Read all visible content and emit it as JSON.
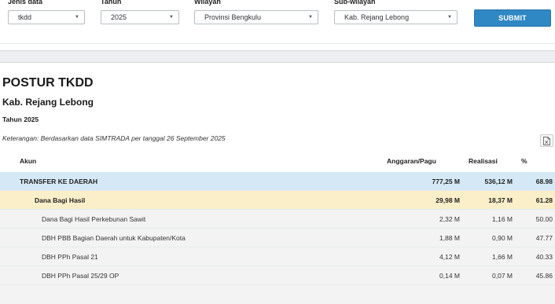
{
  "filters": [
    {
      "label": "Jenis data",
      "value": "tkdd"
    },
    {
      "label": "Tahun",
      "value": "2025"
    },
    {
      "label": "Wilayah",
      "value": "Provinsi Bengkulu"
    },
    {
      "label": "Sub-wilayah",
      "value": "Kab. Rejang Lebong"
    }
  ],
  "submit_label": "SUBMIT",
  "report": {
    "title": "POSTUR TKDD",
    "region": "Kab. Rejang Lebong",
    "year": "Tahun 2025",
    "note": "Keterangan: Berdasarkan data SIMTRADA per tanggal 26 September 2025"
  },
  "export_icon": "excel-export-icon",
  "table": {
    "headers": {
      "akun": "Akun",
      "anggaran": "Anggaran/Pagu",
      "realisasi": "Realisasi",
      "persen": "%"
    },
    "rows": [
      {
        "akun": "TRANSFER KE DAERAH",
        "anggaran": "777,25 M",
        "realisasi": "536,12 M",
        "persen": "68.98"
      },
      {
        "akun": "Dana Bagi Hasil",
        "anggaran": "29,98 M",
        "realisasi": "18,37 M",
        "persen": "61.28"
      },
      {
        "akun": "Dana Bagi Hasil Perkebunan Sawit",
        "anggaran": "2,32 M",
        "realisasi": "1,16 M",
        "persen": "50.00"
      },
      {
        "akun": "DBH PBB Bagian Daerah untuk Kabupaten/Kota",
        "anggaran": "1,88 M",
        "realisasi": "0,90 M",
        "persen": "47.77"
      },
      {
        "akun": "DBH PPh Pasal 21",
        "anggaran": "4,12 M",
        "realisasi": "1,66 M",
        "persen": "40.33"
      },
      {
        "akun": "DBH PPh Pasal 25/29 OP",
        "anggaran": "0,14 M",
        "realisasi": "0,07 M",
        "persen": "45.86"
      }
    ]
  },
  "colors": {
    "submit": "#2f87c4",
    "row_transfer": "#d4e9f5",
    "row_dbh": "#fbefc9",
    "row_detail": "#f3f3f3"
  }
}
